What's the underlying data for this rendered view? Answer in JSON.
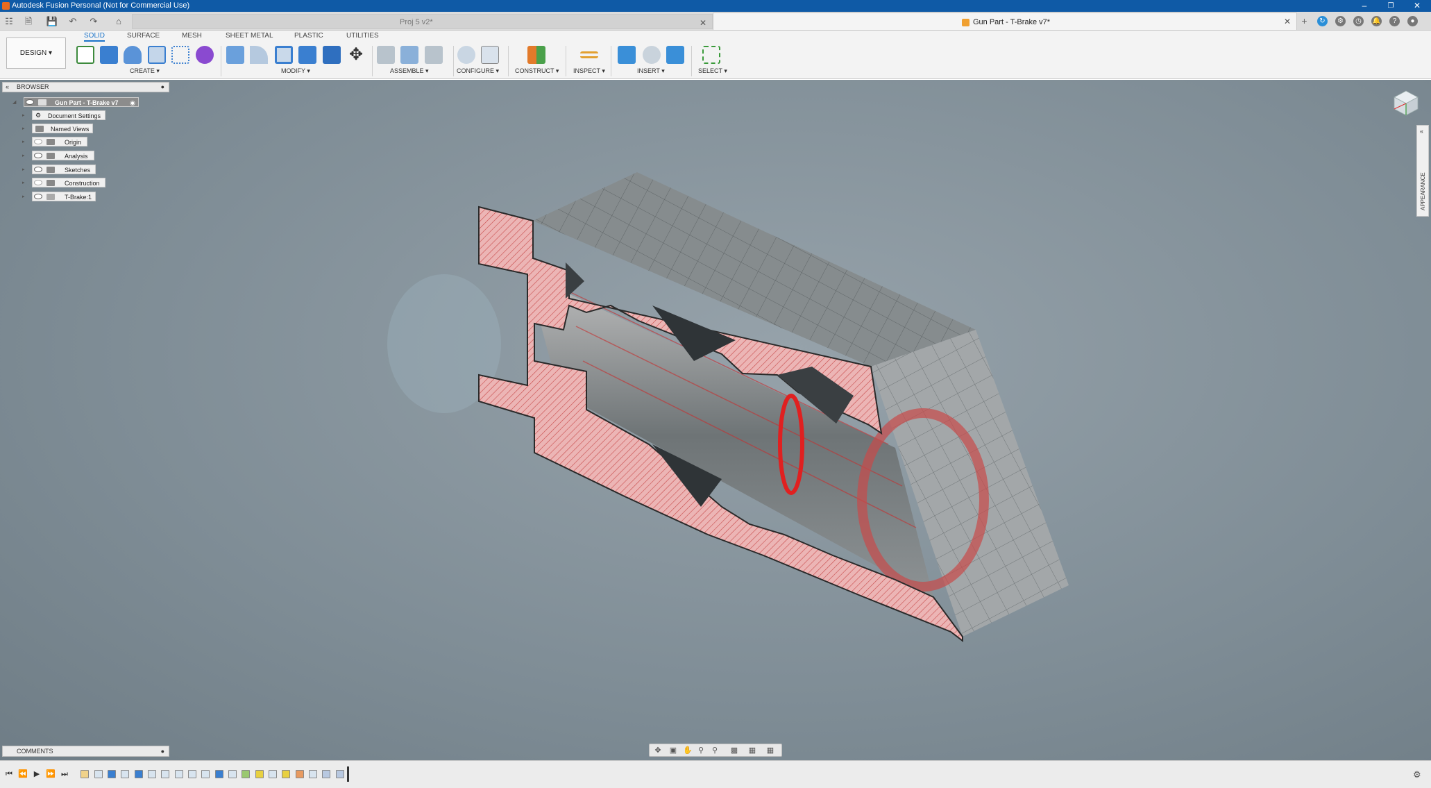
{
  "titlebar": {
    "title": "Autodesk Fusion Personal (Not for Commercial Use)"
  },
  "tabs": [
    {
      "label": "Proj 5 v2*",
      "active": false
    },
    {
      "label": "Gun Part - T-Brake v7*",
      "active": true
    }
  ],
  "toolbar": {
    "workspace": "DESIGN",
    "workspace_tabs": [
      "SOLID",
      "SURFACE",
      "MESH",
      "SHEET METAL",
      "PLASTIC",
      "UTILITIES"
    ],
    "groups": [
      "CREATE",
      "MODIFY",
      "ASSEMBLE",
      "CONFIGURE",
      "CONSTRUCT",
      "INSPECT",
      "INSERT",
      "SELECT"
    ]
  },
  "browser": {
    "title": "BROWSER",
    "root": "Gun Part - T-Brake v7",
    "items": [
      "Document Settings",
      "Named Views",
      "Origin",
      "Analysis",
      "Sketches",
      "Construction",
      "T-Brake:1"
    ]
  },
  "panels": {
    "appearance": "APPEARANCE",
    "comments": "COMMENTS"
  },
  "colors": {
    "titlebar": "#0f5aa6",
    "accent": "#1a73c9",
    "section": "#e8a6a6",
    "body": "#8e9496"
  }
}
